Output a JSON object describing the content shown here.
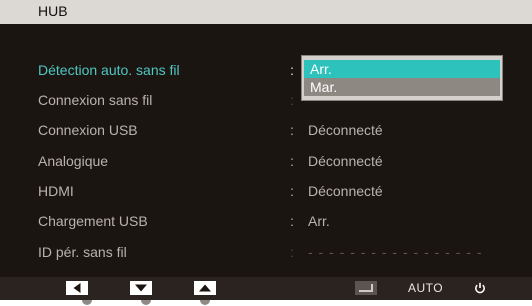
{
  "header": {
    "title": "HUB"
  },
  "menu": {
    "rows": [
      {
        "label": "Détection auto. sans fil",
        "colon": ":",
        "value": ""
      },
      {
        "label": "Connexion sans fil",
        "colon": ":",
        "value": ""
      },
      {
        "label": "Connexion USB",
        "colon": ":",
        "value": "Déconnecté"
      },
      {
        "label": "Analogique",
        "colon": ":",
        "value": "Déconnecté"
      },
      {
        "label": "HDMI",
        "colon": ":",
        "value": "Déconnecté"
      },
      {
        "label": "Chargement USB",
        "colon": ":",
        "value": "Arr."
      },
      {
        "label": "ID pér. sans fil",
        "colon": ":",
        "value": "- - - - - - - - - - - - - - - - -"
      }
    ]
  },
  "dropdown": {
    "options": [
      "Arr.",
      "Mar."
    ],
    "selected": "Arr."
  },
  "footer": {
    "buttons": [
      "left-arrow",
      "down-arrow",
      "up-arrow",
      "enter",
      "auto",
      "power"
    ],
    "auto_label": "AUTO"
  },
  "colors": {
    "selected_text": "#4fc7c2",
    "highlight": "#2ec2bd",
    "background": "#1b1511"
  }
}
